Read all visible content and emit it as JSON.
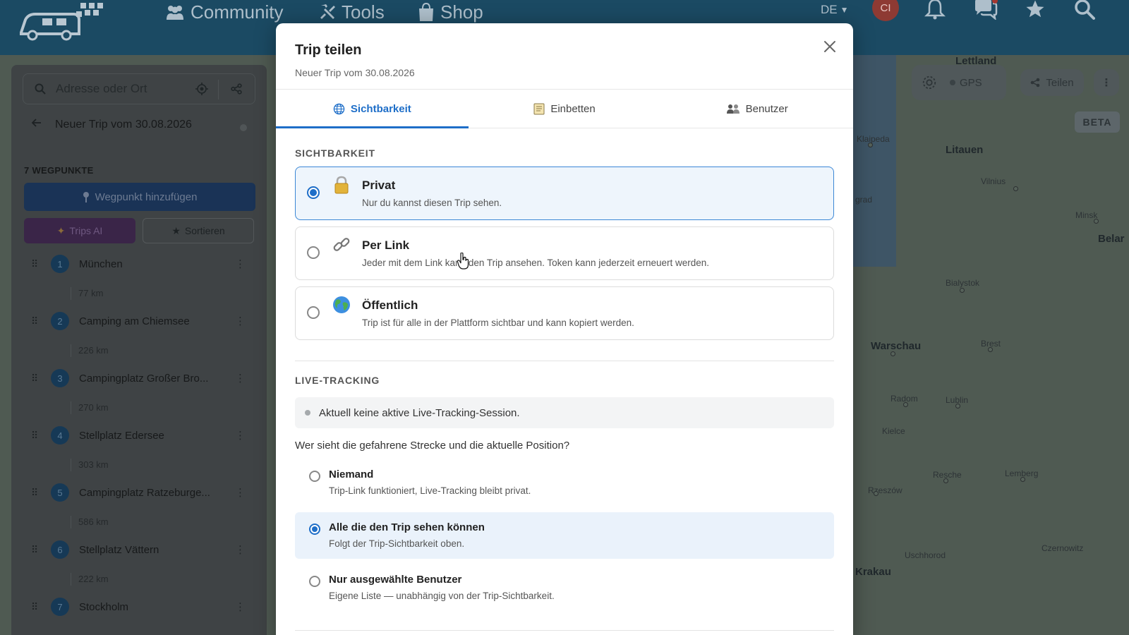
{
  "nav": {
    "community": "Community",
    "tools": "Tools",
    "shop": "Shop",
    "language": "DE",
    "avatar_initials": "CI"
  },
  "map": {
    "labels": [
      "Lettland",
      "Litauen",
      "Klaipeda",
      "Vilnius",
      "Minsk",
      "Belar",
      "Bialystok",
      "Brest",
      "Warschau",
      "Radom",
      "Lublin",
      "Kielce",
      "Rzeszów",
      "Resche",
      "Lemberg",
      "Uschhorod",
      "Czernowitz",
      "Krakau",
      "grad"
    ],
    "gps_label": "GPS",
    "share_label": "Teilen",
    "beta_label": "BETA"
  },
  "sidebar": {
    "search_placeholder": "Adresse oder Ort",
    "trip_title": "Neuer Trip vom 30.08.2026",
    "waypoints_heading": "7 WEGPUNKTE",
    "add_waypoint": "Wegpunkt hinzufügen",
    "trips_ai": "Trips AI",
    "sort": "Sortieren",
    "waypoints": [
      {
        "num": "1",
        "name": "München",
        "dist": "77 km"
      },
      {
        "num": "2",
        "name": "Camping am Chiemsee",
        "dist": "226 km"
      },
      {
        "num": "3",
        "name": "Campingplatz Großer Bro...",
        "dist": "270 km"
      },
      {
        "num": "4",
        "name": "Stellplatz Edersee",
        "dist": "303 km"
      },
      {
        "num": "5",
        "name": "Campingplatz Ratzeburge...",
        "dist": "586 km"
      },
      {
        "num": "6",
        "name": "Stellplatz Vättern",
        "dist": "222 km"
      },
      {
        "num": "7",
        "name": "Stockholm",
        "dist": ""
      }
    ]
  },
  "modal": {
    "title": "Trip teilen",
    "subtitle": "Neuer Trip vom 30.08.2026",
    "tabs": [
      {
        "label": "Sichtbarkeit",
        "active": true
      },
      {
        "label": "Einbetten",
        "active": false
      },
      {
        "label": "Benutzer",
        "active": false
      }
    ],
    "visibility_heading": "SICHTBARKEIT",
    "visibility_options": [
      {
        "title": "Privat",
        "desc": "Nur du kannst diesen Trip sehen.",
        "selected": true,
        "icon": "lock-icon"
      },
      {
        "title": "Per Link",
        "desc": "Jeder mit dem Link kann den Trip ansehen. Token kann jederzeit erneuert werden.",
        "selected": false,
        "icon": "link-icon"
      },
      {
        "title": "Öffentlich",
        "desc": "Trip ist für alle in der Plattform sichtbar und kann kopiert werden.",
        "selected": false,
        "icon": "globe-icon"
      }
    ],
    "live_heading": "LIVE-TRACKING",
    "live_status": "Aktuell keine aktive Live-Tracking-Session.",
    "live_question": "Wer sieht die gefahrene Strecke und die aktuelle Position?",
    "live_options": [
      {
        "title": "Niemand",
        "desc": "Trip-Link funktioniert, Live-Tracking bleibt privat.",
        "selected": false
      },
      {
        "title": "Alle die den Trip sehen können",
        "desc": "Folgt der Trip-Sichtbarkeit oben.",
        "selected": true
      },
      {
        "title": "Nur ausgewählte Benutzer",
        "desc": "Eigene Liste — unabhängig von der Trip-Sichtbarkeit.",
        "selected": false
      }
    ]
  },
  "colors": {
    "accent": "#1e6ec8",
    "topbar": "#1b4a63",
    "selected_bg": "#eef5fc"
  }
}
